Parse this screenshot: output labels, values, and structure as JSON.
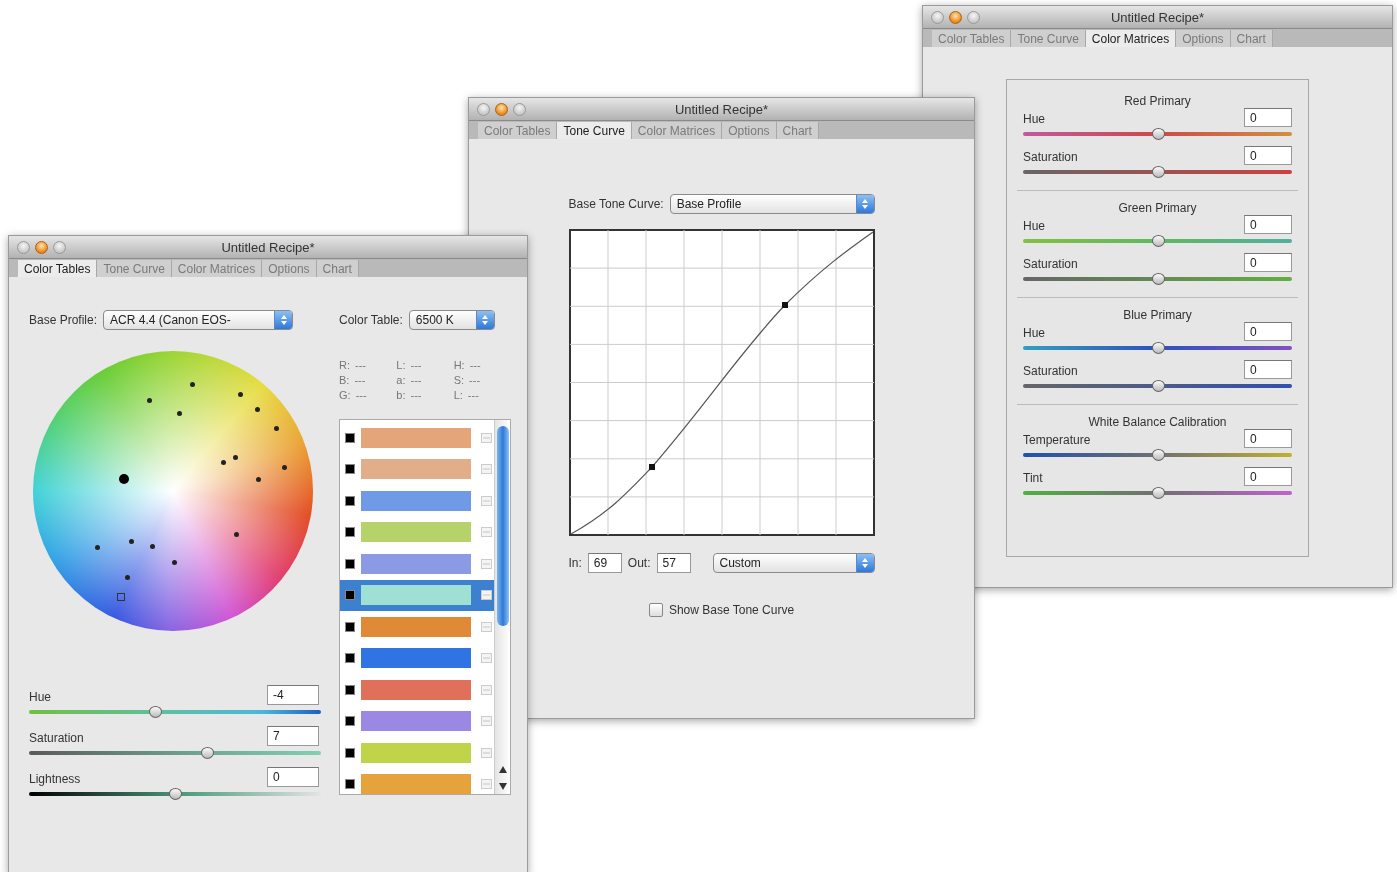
{
  "windows": [
    {
      "kind": "color-matrices",
      "title": "Untitled Recipe*",
      "tabs": [
        {
          "label": "Color Tables",
          "selected": false
        },
        {
          "label": "Tone Curve",
          "selected": false
        },
        {
          "label": "Color Matrices",
          "selected": true
        },
        {
          "label": "Options",
          "selected": false
        },
        {
          "label": "Chart",
          "selected": false
        }
      ],
      "groups": [
        {
          "heading": "Red Primary",
          "sliders": [
            {
              "label": "Hue",
              "value": "0",
              "level": 0.5,
              "kind": "red-hue"
            },
            {
              "label": "Saturation",
              "value": "0",
              "level": 0.5,
              "kind": "red-saturation"
            }
          ]
        },
        {
          "heading": "Green Primary",
          "sliders": [
            {
              "label": "Hue",
              "value": "0",
              "level": 0.5,
              "kind": "green-hue"
            },
            {
              "label": "Saturation",
              "value": "0",
              "level": 0.5,
              "kind": "green-saturation"
            }
          ]
        },
        {
          "heading": "Blue Primary",
          "sliders": [
            {
              "label": "Hue",
              "value": "0",
              "level": 0.5,
              "kind": "blue-hue"
            },
            {
              "label": "Saturation",
              "value": "0",
              "level": 0.5,
              "kind": "blue-saturation"
            }
          ]
        },
        {
          "heading": "White Balance Calibration",
          "sliders": [
            {
              "label": "Temperature",
              "value": "0",
              "level": 0.5,
              "kind": "temperature"
            },
            {
              "label": "Tint",
              "value": "0",
              "level": 0.5,
              "kind": "tint"
            }
          ]
        }
      ]
    },
    {
      "kind": "tone-curve",
      "title": "Untitled Recipe*",
      "tabs": [
        {
          "label": "Color Tables",
          "selected": false
        },
        {
          "label": "Tone Curve",
          "selected": true
        },
        {
          "label": "Color Matrices",
          "selected": false
        },
        {
          "label": "Options",
          "selected": false
        },
        {
          "label": "Chart",
          "selected": false
        }
      ],
      "base_curve": {
        "label": "Base Tone Curve:",
        "value": "Base Profile"
      },
      "input": {
        "label": "In:",
        "value": "69"
      },
      "output": {
        "label": "Out:",
        "value": "57"
      },
      "preset": {
        "value": "Custom"
      },
      "show_base": {
        "label": "Show Base Tone Curve",
        "checked": false
      }
    },
    {
      "kind": "color-tables",
      "title": "Untitled Recipe*",
      "tabs": [
        {
          "label": "Color Tables",
          "selected": true
        },
        {
          "label": "Tone Curve",
          "selected": false
        },
        {
          "label": "Color Matrices",
          "selected": false
        },
        {
          "label": "Options",
          "selected": false
        },
        {
          "label": "Chart",
          "selected": false
        }
      ],
      "base_profile": {
        "label": "Base Profile:",
        "value": "ACR 4.4 (Canon EOS-"
      },
      "color_table": {
        "label": "Color Table:",
        "value": "6500 K"
      },
      "readouts": [
        {
          "label": "R:",
          "value": "---"
        },
        {
          "label": "L:",
          "value": "---"
        },
        {
          "label": "H:",
          "value": "---"
        },
        {
          "label": "B:",
          "value": "---"
        },
        {
          "label": "a:",
          "value": "---"
        },
        {
          "label": "S:",
          "value": "---"
        },
        {
          "label": "G:",
          "value": "---"
        },
        {
          "label": "b:",
          "value": "---"
        },
        {
          "label": "L:",
          "value": "---"
        }
      ],
      "swatches": [
        {
          "color": "#e4a57a",
          "selected": false
        },
        {
          "color": "#e2ae8a",
          "selected": false
        },
        {
          "color": "#6f9ae6",
          "selected": false
        },
        {
          "color": "#b6d26a",
          "selected": false
        },
        {
          "color": "#8a9be4",
          "selected": false
        },
        {
          "color": "#9fe0d4",
          "selected": true
        },
        {
          "color": "#e08a38",
          "selected": false
        },
        {
          "color": "#2f74e2",
          "selected": false
        },
        {
          "color": "#e0705a",
          "selected": false
        },
        {
          "color": "#9b88e4",
          "selected": false
        },
        {
          "color": "#bfd448",
          "selected": false
        },
        {
          "color": "#e6a23c",
          "selected": false
        }
      ],
      "sliders": [
        {
          "label": "Hue",
          "value": "-4",
          "level": 0.43,
          "kind": "hue"
        },
        {
          "label": "Saturation",
          "value": "7",
          "level": 0.61,
          "kind": "saturation"
        },
        {
          "label": "Lightness",
          "value": "0",
          "level": 0.5,
          "kind": "lightness"
        }
      ]
    }
  ]
}
